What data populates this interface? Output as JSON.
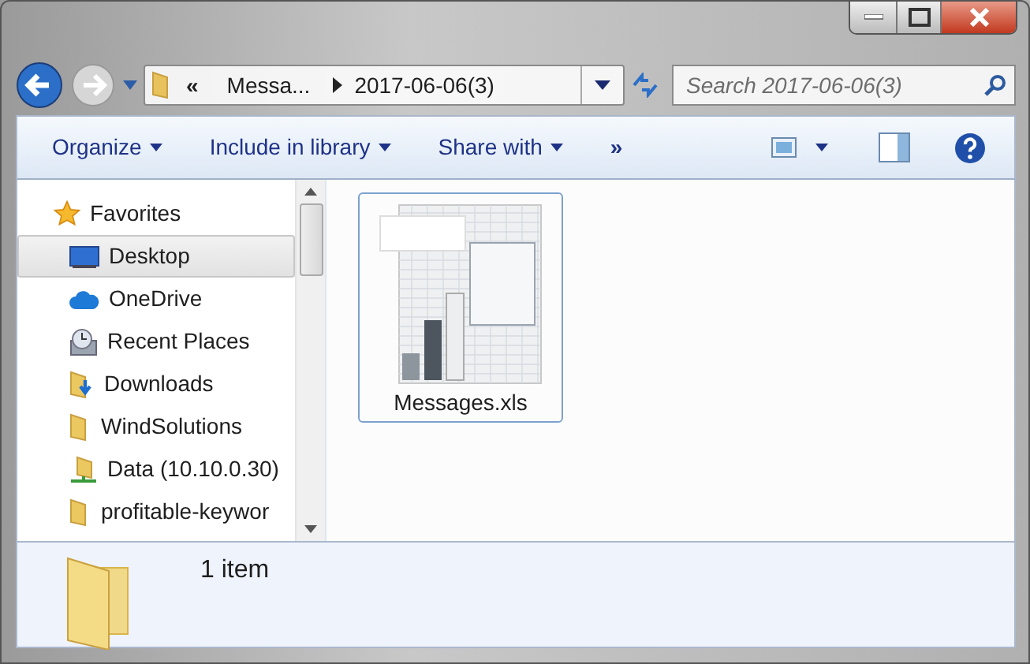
{
  "address": {
    "segments": [
      {
        "kind": "overflow",
        "label": "«"
      },
      {
        "kind": "folder",
        "label": "Messa..."
      },
      {
        "kind": "folder",
        "label": "2017-06-06(3)"
      }
    ]
  },
  "search": {
    "placeholder": "Search 2017-06-06(3)"
  },
  "toolbar": {
    "items": [
      {
        "label": "Organize",
        "dropdown": true
      },
      {
        "label": "Include in library",
        "dropdown": true
      },
      {
        "label": "Share with",
        "dropdown": true
      },
      {
        "label": "»",
        "dropdown": false
      }
    ]
  },
  "sidebar": {
    "items": [
      {
        "label": "Favorites",
        "kind": "star",
        "selected": false,
        "children": [
          {
            "label": "Desktop",
            "kind": "desktop",
            "selected": true
          },
          {
            "label": "OneDrive",
            "kind": "cloud",
            "selected": false
          },
          {
            "label": "Recent Places",
            "kind": "recent",
            "selected": false
          },
          {
            "label": "Downloads",
            "kind": "downloads",
            "selected": false
          },
          {
            "label": "WindSolutions",
            "kind": "folder",
            "selected": false
          },
          {
            "label": "Data (10.10.0.30)",
            "kind": "network",
            "selected": false
          },
          {
            "label": "profitable-keywor",
            "kind": "folder",
            "selected": false
          }
        ]
      }
    ]
  },
  "files": [
    {
      "name": "Messages.xls",
      "selected": true
    }
  ],
  "details": {
    "count": "1 item"
  }
}
